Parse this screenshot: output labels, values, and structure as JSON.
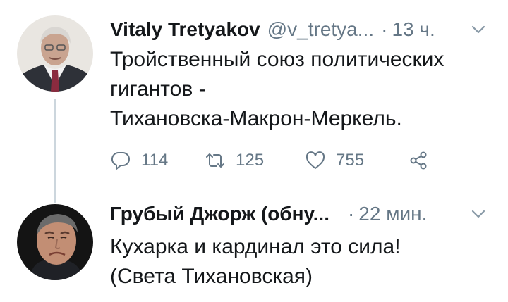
{
  "tweets": [
    {
      "author": "Vitaly Tretyakov",
      "handle": "@v_tretya...",
      "separator": "·",
      "time": "13 ч.",
      "text_lines": [
        "Тройственный союз политических",
        "гигантов -",
        "Тихановска-Макрон-Меркель."
      ],
      "replies": "114",
      "retweets": "125",
      "likes": "755",
      "avatar_icon": "avatar-photo-man-gray-hair"
    },
    {
      "author": "Грубый Джорж (обну...",
      "separator": "·",
      "time": "22 мин.",
      "text_lines": [
        "Кухарка и кардинал это сила!",
        "(Света Тихановская)"
      ],
      "avatar_icon": "avatar-photo-man-frowning"
    }
  ],
  "colors": {
    "text": "#14171a",
    "secondary": "#657786",
    "thread_line": "#ccd6dd"
  }
}
